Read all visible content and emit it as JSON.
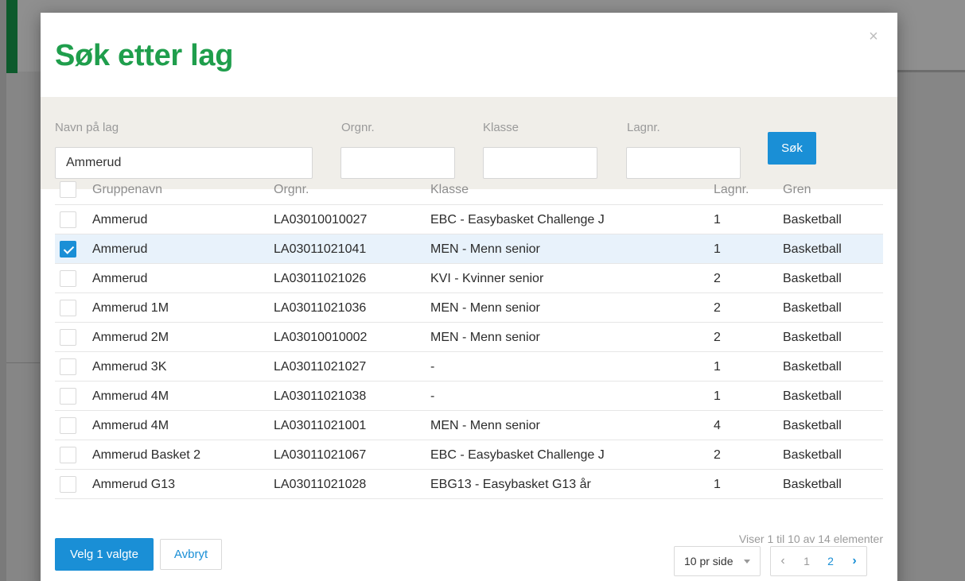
{
  "modal": {
    "title": "Søk etter lag",
    "close_label": "×"
  },
  "search": {
    "name_label": "Navn på lag",
    "name_value": "Ammerud",
    "org_label": "Orgnr.",
    "org_value": "",
    "klasse_label": "Klasse",
    "klasse_value": "",
    "lagnr_label": "Lagnr.",
    "lagnr_value": "",
    "submit_label": "Søk"
  },
  "table": {
    "headers": {
      "name": "Gruppenavn",
      "org": "Orgnr.",
      "klasse": "Klasse",
      "lagnr": "Lagnr.",
      "gren": "Gren"
    },
    "rows": [
      {
        "name": "Ammerud",
        "org": "LA03010010027",
        "klasse": "EBC - Easybasket Challenge J",
        "lagnr": "1",
        "gren": "Basketball",
        "checked": false
      },
      {
        "name": "Ammerud",
        "org": "LA03011021041",
        "klasse": "MEN - Menn senior",
        "lagnr": "1",
        "gren": "Basketball",
        "checked": true
      },
      {
        "name": "Ammerud",
        "org": "LA03011021026",
        "klasse": "KVI - Kvinner senior",
        "lagnr": "2",
        "gren": "Basketball",
        "checked": false
      },
      {
        "name": "Ammerud 1M",
        "org": "LA03011021036",
        "klasse": "MEN - Menn senior",
        "lagnr": "2",
        "gren": "Basketball",
        "checked": false
      },
      {
        "name": "Ammerud 2M",
        "org": "LA03010010002",
        "klasse": "MEN - Menn senior",
        "lagnr": "2",
        "gren": "Basketball",
        "checked": false
      },
      {
        "name": "Ammerud 3K",
        "org": "LA03011021027",
        "klasse": "-",
        "lagnr": "1",
        "gren": "Basketball",
        "checked": false
      },
      {
        "name": "Ammerud 4M",
        "org": "LA03011021038",
        "klasse": "-",
        "lagnr": "1",
        "gren": "Basketball",
        "checked": false
      },
      {
        "name": "Ammerud 4M",
        "org": "LA03011021001",
        "klasse": "MEN - Menn senior",
        "lagnr": "4",
        "gren": "Basketball",
        "checked": false
      },
      {
        "name": "Ammerud Basket 2",
        "org": "LA03011021067",
        "klasse": "EBC - Easybasket Challenge J",
        "lagnr": "2",
        "gren": "Basketball",
        "checked": false
      },
      {
        "name": "Ammerud G13",
        "org": "LA03011021028",
        "klasse": "EBG13 - Easybasket G13 år",
        "lagnr": "1",
        "gren": "Basketball",
        "checked": false
      }
    ]
  },
  "footer": {
    "select_label": "Velg 1 valgte",
    "cancel_label": "Avbryt",
    "paging_info": "Viser 1 til 10 av 14 elementer",
    "per_page": "10 pr side",
    "pages": [
      "1",
      "2"
    ],
    "prev_glyph": "‹",
    "next_glyph": "›"
  },
  "colors": {
    "title_green": "#1f9e4c",
    "accent_blue": "#1a8fd6",
    "selected_row": "#e8f2fb",
    "panel_bg": "#f0eee9"
  }
}
